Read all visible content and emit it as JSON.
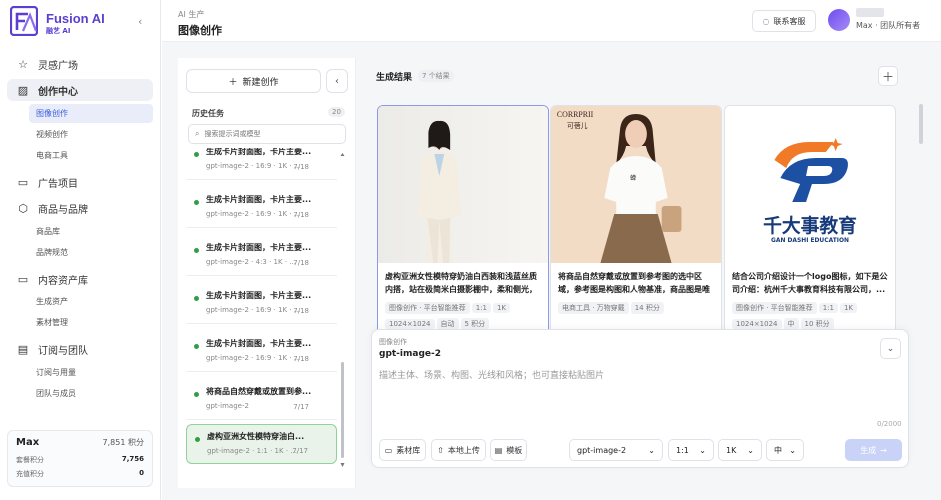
{
  "brand": {
    "name": "Fusion AI",
    "sub": "融艺 AI",
    "logo_text": "FA",
    "accent": "#5b3fd1"
  },
  "sidebar": {
    "sections": [
      {
        "label": "灵感广场",
        "icon": "star-icon"
      },
      {
        "label": "创作中心",
        "icon": "image-icon",
        "active": true,
        "subs": [
          {
            "label": "图像创作",
            "active": true
          },
          {
            "label": "视频创作"
          },
          {
            "label": "电商工具"
          }
        ]
      },
      {
        "label": "广告项目",
        "icon": "folder-icon"
      },
      {
        "label": "商品与品牌",
        "icon": "box-icon",
        "subs": [
          {
            "label": "商品库"
          },
          {
            "label": "品牌规范"
          }
        ]
      },
      {
        "label": "内容资产库",
        "icon": "folder-icon",
        "subs": [
          {
            "label": "生成资产"
          },
          {
            "label": "素材管理"
          }
        ]
      },
      {
        "label": "订阅与团队",
        "icon": "calendar-icon",
        "subs": [
          {
            "label": "订阅与用量"
          },
          {
            "label": "团队与成员"
          }
        ]
      }
    ],
    "credits": {
      "plan": "Max",
      "total": "7,851 积分",
      "rows": [
        {
          "label": "套餐积分",
          "value": "7,756"
        },
        {
          "label": "充值积分",
          "value": "0"
        }
      ]
    }
  },
  "header": {
    "breadcrumb": "AI 生产",
    "title": "图像创作",
    "support_label": "联系客服",
    "user_line": "Max · 团队所有者"
  },
  "history": {
    "new_label": "新建创作",
    "title": "历史任务",
    "count": "20",
    "search_placeholder": "搜索提示词或模型",
    "items": [
      {
        "title": "生成卡片封面图，卡片主要...",
        "meta": "gpt-image-2 · 16:9 · 1K · ...",
        "date": "7/18"
      },
      {
        "title": "生成卡片封面图，卡片主要...",
        "meta": "gpt-image-2 · 16:9 · 1K · ...",
        "date": "7/18"
      },
      {
        "title": "生成卡片封面图，卡片主要...",
        "meta": "gpt-image-2 · 4:3 · 1K · ...",
        "date": "7/18"
      },
      {
        "title": "生成卡片封面图，卡片主要...",
        "meta": "gpt-image-2 · 16:9 · 1K · ...",
        "date": "7/18"
      },
      {
        "title": "生成卡片封面图，卡片主要...",
        "meta": "gpt-image-2 · 16:9 · 1K · ...",
        "date": "7/18"
      },
      {
        "title": "将商品自然穿戴或放置到参...",
        "meta": "gpt-image-2",
        "date": "7/17"
      },
      {
        "title": "虚构亚洲女性模特穿油白...",
        "meta": "gpt-image-2 · 1:1 · 1K · ...",
        "date": "7/17",
        "selected": true
      }
    ]
  },
  "results": {
    "title": "生成结果",
    "count": "7 个结果",
    "cards": [
      {
        "desc": "虚构亚洲女性模特穿奶油白西装和浅蓝丝质内搭，站在极简米白摄影棚中，柔和侧光，4:...",
        "tags": [
          "图像创作 · 平台智能推荐",
          "1:1",
          "1K",
          "1024×1024",
          "自动",
          "5 积分"
        ],
        "selected": true
      },
      {
        "desc": "将商品自然穿戴或放置到参考图的选中区域，参考图是构图和人物基准，商品图是唯一需...",
        "tags": [
          "电商工具 · 万物穿戴",
          "14 积分"
        ],
        "brand_top": "CORRPRII",
        "brand_sub": "可蓓儿"
      },
      {
        "desc": "结合公司介绍设计一个logo图标，如下是公司介绍：杭州千大事教育科技有限公司，...",
        "tags": [
          "图像创作 · 平台智能推荐",
          "1:1",
          "1K",
          "1024×1024",
          "中",
          "10 积分"
        ],
        "logo_cn": "千大事教育",
        "logo_en": "GAN DASHI EDUCATION"
      }
    ]
  },
  "composer": {
    "label": "图像创作",
    "model": "gpt-image-2",
    "placeholder": "描述主体、场景、构图、光线和风格；也可直接粘贴图片",
    "count": "0/2000",
    "materials_label": "素材库",
    "upload_label": "本地上传",
    "template_label": "模板",
    "model_select": "gpt-image-2",
    "ratio": "1:1",
    "res": "1K",
    "quality": "中",
    "generate_label": "生成"
  }
}
